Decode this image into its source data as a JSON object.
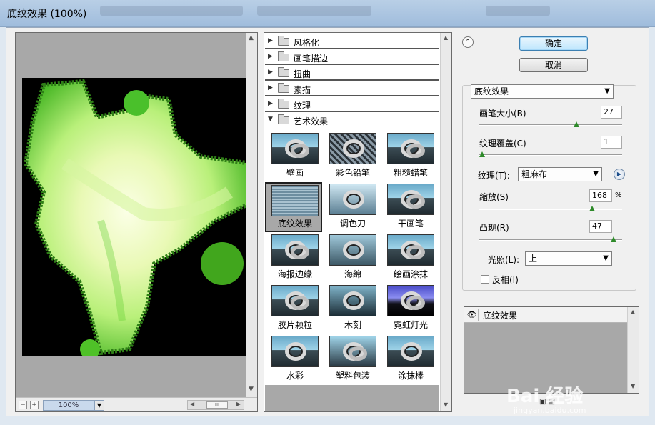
{
  "window": {
    "title": "底纹效果 (100%)"
  },
  "preview": {
    "zoom_minus": "−",
    "zoom_plus": "+",
    "zoom_value": "100%",
    "hscroll_thumb": "III"
  },
  "gallery": {
    "categories": [
      {
        "label": "风格化",
        "expanded": false
      },
      {
        "label": "画笔描边",
        "expanded": false
      },
      {
        "label": "扭曲",
        "expanded": false
      },
      {
        "label": "素描",
        "expanded": false
      },
      {
        "label": "纹理",
        "expanded": false
      },
      {
        "label": "艺术效果",
        "expanded": true
      }
    ],
    "filters": [
      "壁画",
      "彩色铅笔",
      "粗糙蜡笔",
      "底纹效果",
      "调色刀",
      "干画笔",
      "海报边缘",
      "海绵",
      "绘画涂抹",
      "胶片颗粒",
      "木刻",
      "霓虹灯光",
      "水彩",
      "塑料包装",
      "涂抹棒"
    ],
    "selected_filter": "底纹效果"
  },
  "controls": {
    "ok_label": "确定",
    "cancel_label": "取消",
    "filter_select": "底纹效果",
    "brush_size_label": "画笔大小(B)",
    "brush_size_value": "27",
    "texture_coverage_label": "纹理覆盖(C)",
    "texture_coverage_value": "1",
    "texture_label": "纹理(T):",
    "texture_value": "粗麻布",
    "scaling_label": "缩放(S)",
    "scaling_value": "168",
    "scaling_unit": "%",
    "relief_label": "凸现(R)",
    "relief_value": "47",
    "light_label": "光照(L):",
    "light_value": "上",
    "invert_label": "反相(I)",
    "invert_checked": false
  },
  "layers": {
    "items": [
      {
        "label": "底纹效果",
        "visible": true
      }
    ]
  },
  "watermark": {
    "text": "Bai 经验",
    "sub": "jingyan.baidu.com"
  },
  "colors": {
    "accent": "#3c7fb1",
    "slider_knob": "#2e8a2a",
    "preview_bg": "#a8a8a8"
  }
}
